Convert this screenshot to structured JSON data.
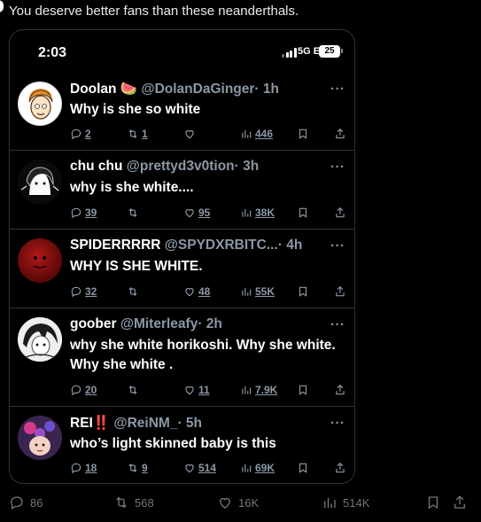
{
  "post": {
    "text": "You deserve better fans than these neanderthals."
  },
  "phone": {
    "time": "2:03",
    "network": "5G E",
    "battery": "25"
  },
  "tweets": [
    {
      "name": "Doolan",
      "emoji": "🍉",
      "handle": "@DolanDaGinger",
      "time": "· 1h",
      "text": "Why is she so white",
      "replies": "2",
      "retweets": "1",
      "likes": "",
      "views": "446"
    },
    {
      "name": "chu chu",
      "handle": "@prettyd3v0tion",
      "time": "· 3h",
      "text": "why is she white....",
      "replies": "39",
      "retweets": "",
      "likes": "95",
      "views": "38K"
    },
    {
      "name": "SPIDERRRRR",
      "handle": "@SPYDXRBITC...",
      "time": "· 4h",
      "text": "WHY IS SHE WHITE.",
      "replies": "32",
      "retweets": "",
      "likes": "48",
      "views": "55K"
    },
    {
      "name": "goober",
      "handle": "@Miterleafy",
      "time": "· 2h",
      "text": "why she white horikoshi. Why she white. Why she white .",
      "replies": "20",
      "retweets": "",
      "likes": "11",
      "views": "7.9K"
    },
    {
      "name": "REI",
      "exclaim": "‼️",
      "handle": "@ReiNM_",
      "time": "· 5h",
      "text": "who’s light skinned baby is this",
      "replies": "18",
      "retweets": "9",
      "likes": "514",
      "views": "69K"
    }
  ],
  "more_label": "···",
  "post_stats": {
    "replies": "86",
    "retweets": "568",
    "likes": "16K",
    "views": "514K"
  }
}
